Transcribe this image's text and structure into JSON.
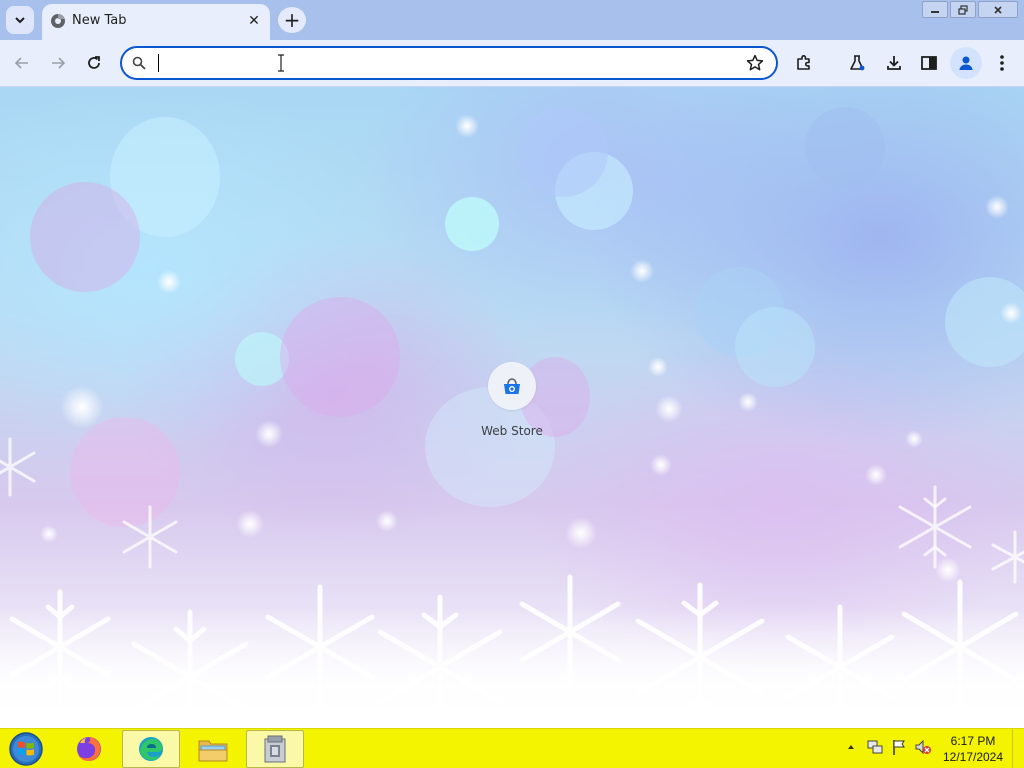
{
  "browser": {
    "tab": {
      "title": "New Tab",
      "favicon": "chrome-newtab-icon"
    },
    "omnibox": {
      "value": "",
      "placeholder": ""
    },
    "toolbar_icons": [
      "back-icon",
      "forward-icon",
      "reload-icon",
      "bookmark-star-icon",
      "extensions-icon",
      "labs-flask-icon",
      "download-icon",
      "side-panel-icon",
      "profile-avatar-icon",
      "menu-kebab-icon"
    ]
  },
  "new_tab_page": {
    "shortcuts": [
      {
        "label": "Web Store",
        "icon": "chrome-web-store-icon"
      }
    ]
  },
  "taskbar": {
    "apps": [
      "windows-start-icon",
      "firefox-icon",
      "edge-icon",
      "file-explorer-icon",
      "app-icon"
    ],
    "clock": {
      "time": "6:17 PM",
      "date": "12/17/2024"
    },
    "accent": "#f4f400"
  },
  "colors": {
    "accent": "#0b57d0",
    "toolbar_bg": "#e8eefc",
    "tabstrip_bg": "#a8c0ec"
  }
}
